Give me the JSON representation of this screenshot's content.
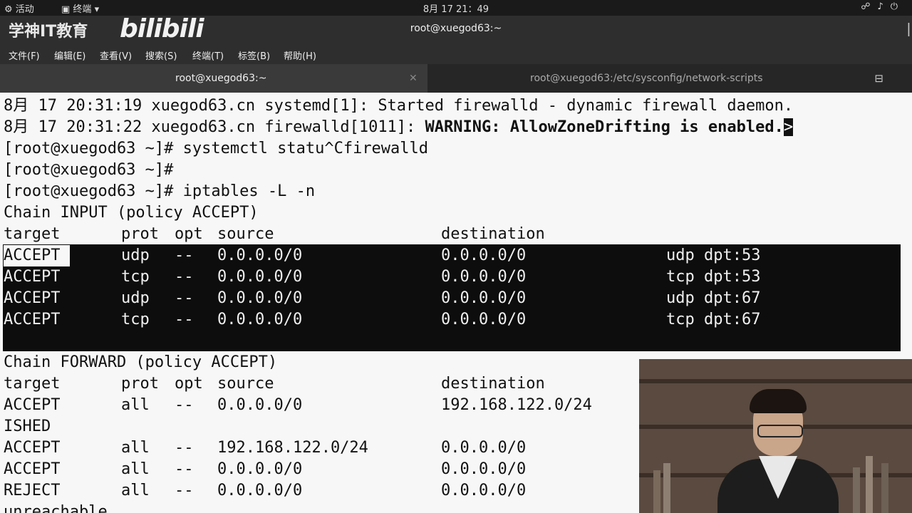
{
  "topbar": {
    "activities": "活动",
    "app_menu": "终端",
    "clock": "8月 17 21：49"
  },
  "window": {
    "title": "root@xuegod63:~",
    "watermark_text": "学神IT教育",
    "watermark_bili": "bilibili"
  },
  "menubar": [
    "文件(F)",
    "编辑(E)",
    "查看(V)",
    "搜索(S)",
    "终端(T)",
    "标签(B)",
    "帮助(H)"
  ],
  "tabs": [
    {
      "label": "root@xuegod63:~",
      "active": true
    },
    {
      "label": "root@xuegod63:/etc/sysconfig/network-scripts",
      "active": false
    }
  ],
  "terminal": {
    "log1": "8月 17 20:31:19 xuegod63.cn systemd[1]: Started firewalld - dynamic firewall daemon.",
    "log2_prefix": "8月 17 20:31:22 xuegod63.cn firewalld[1011]: ",
    "log2_warning": "WARNING: AllowZoneDrifting is enabled.",
    "log2_cursor": ">",
    "cmd1": "[root@xuegod63 ~]# systemctl statu^Cfirewalld",
    "cmd2": "[root@xuegod63 ~]#",
    "cmd3": "[root@xuegod63 ~]# iptables -L -n",
    "chain_input": "Chain INPUT (policy ACCEPT)",
    "header": {
      "target": "target",
      "prot": "prot",
      "opt": "opt",
      "source": "source",
      "destination": "destination"
    },
    "input_rules": [
      {
        "target": "ACCEPT",
        "prot": "udp",
        "opt": "--",
        "source": "0.0.0.0/0",
        "destination": "0.0.0.0/0",
        "extra": "udp dpt:53"
      },
      {
        "target": "ACCEPT",
        "prot": "tcp",
        "opt": "--",
        "source": "0.0.0.0/0",
        "destination": "0.0.0.0/0",
        "extra": "tcp dpt:53"
      },
      {
        "target": "ACCEPT",
        "prot": "udp",
        "opt": "--",
        "source": "0.0.0.0/0",
        "destination": "0.0.0.0/0",
        "extra": "udp dpt:67"
      },
      {
        "target": "ACCEPT",
        "prot": "tcp",
        "opt": "--",
        "source": "0.0.0.0/0",
        "destination": "0.0.0.0/0",
        "extra": "tcp dpt:67"
      }
    ],
    "chain_forward": "Chain FORWARD (policy ACCEPT)",
    "forward_rules": [
      {
        "target": "ACCEPT",
        "prot": "all",
        "opt": "--",
        "source": "0.0.0.0/0",
        "destination": "192.168.122.0/24",
        "extra": ""
      },
      {
        "target": "ISHED",
        "prot": "",
        "opt": "",
        "source": "",
        "destination": "",
        "extra": ""
      },
      {
        "target": "ACCEPT",
        "prot": "all",
        "opt": "--",
        "source": "192.168.122.0/24",
        "destination": "0.0.0.0/0",
        "extra": ""
      },
      {
        "target": "ACCEPT",
        "prot": "all",
        "opt": "--",
        "source": "0.0.0.0/0",
        "destination": "0.0.0.0/0",
        "extra": ""
      },
      {
        "target": "REJECT",
        "prot": "all",
        "opt": "--",
        "source": "0.0.0.0/0",
        "destination": "0.0.0.0/0",
        "extra": ""
      }
    ],
    "trailing": "unreachable"
  },
  "colors": {
    "terminal_bg": "#f7f7f7",
    "terminal_fg": "#111111",
    "selection_bg": "#0d0d0d",
    "chrome_bg": "#2e2e2e"
  }
}
